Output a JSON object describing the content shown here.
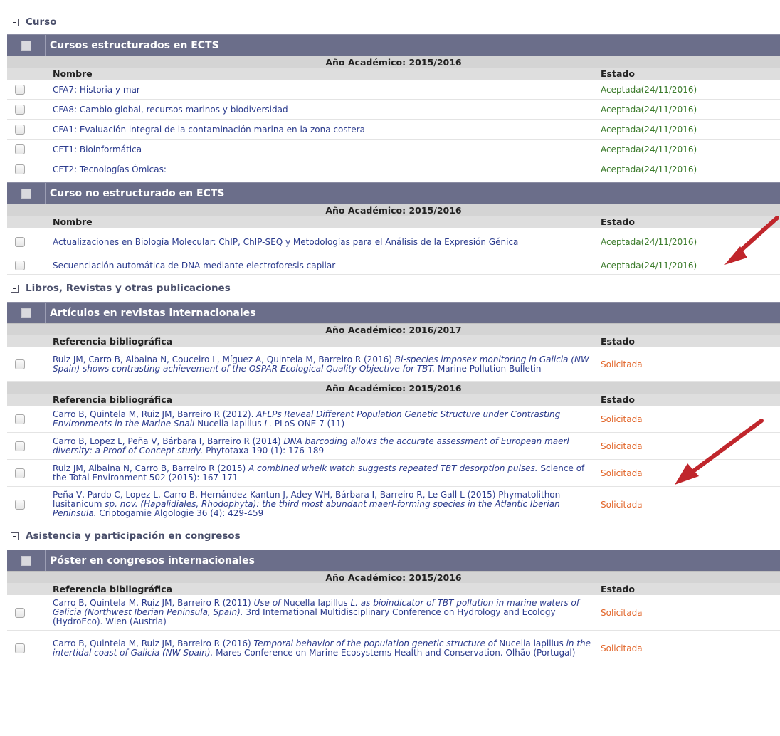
{
  "sections": {
    "curso": {
      "title": "Curso"
    },
    "libros": {
      "title": "Libros, Revistas y otras publicaciones"
    },
    "asistencia": {
      "title": "Asistencia y participación en congresos"
    }
  },
  "curso": {
    "ects": {
      "title": "Cursos estructurados en ECTS",
      "year": "Año Académico: 2015/2016",
      "col_name": "Nombre",
      "col_state": "Estado",
      "rows": [
        {
          "name": "CFA7: Historia y mar",
          "state": "Aceptada(24/11/2016)"
        },
        {
          "name": "CFA8: Cambio global, recursos marinos y biodiversidad",
          "state": "Aceptada(24/11/2016)"
        },
        {
          "name": "CFA1: Evaluación integral de la contaminación marina en la zona costera",
          "state": "Aceptada(24/11/2016)"
        },
        {
          "name": "CFT1: Bioinformática",
          "state": "Aceptada(24/11/2016)"
        },
        {
          "name": "CFT2: Tecnologías Ómicas:",
          "state": "Aceptada(24/11/2016)"
        }
      ]
    },
    "noects": {
      "title": "Curso no estructurado en ECTS",
      "year": "Año Académico: 2015/2016",
      "col_name": "Nombre",
      "col_state": "Estado",
      "rows": [
        {
          "name": "Actualizaciones en Biología Molecular: ChIP, ChIP-SEQ y Metodologías para el Análisis de la Expresión Génica",
          "state": "Aceptada(24/11/2016)"
        },
        {
          "name": "Secuenciación automática de DNA mediante electroforesis capilar",
          "state": "Aceptada(24/11/2016)"
        }
      ]
    }
  },
  "libros": {
    "articulos": {
      "title": "Artículos en revistas internacionales",
      "year1": "Año Académico: 2016/2017",
      "year2": "Año Académico: 2015/2016",
      "col_ref": "Referencia bibliográfica",
      "col_state": "Estado",
      "r1": {
        "a": "Ruiz JM, Carro B, Albaina N, Couceiro L, Míguez A, Quintela M, Barreiro R (2016) ",
        "i": "Bi-species imposex monitoring in Galicia (NW Spain) shows contrasting achievement of the OSPAR Ecological Quality Objective for TBT.",
        "b": " Marine Pollution Bulletin",
        "state": "Solicitada"
      },
      "r2": {
        "a": "Carro B, Quintela M, Ruiz JM, Barreiro R (2012). ",
        "i": "AFLPs Reveal Different Population Genetic Structure under Contrasting Environments in the Marine Snail",
        "b": " Nucella lapillus ",
        "i2": "L.",
        "c": " PLoS ONE 7 (11)",
        "state": "Solicitada"
      },
      "r3": {
        "a": "Carro B, Lopez L, Peña V, Bárbara I, Barreiro R (2014) ",
        "i": "DNA barcoding allows the accurate assessment of European maerl diversity: a Proof-of-Concept study.",
        "b": " Phytotaxa 190 (1): 176-189",
        "state": "Solicitada"
      },
      "r4": {
        "a": "Ruiz JM, Albaina N, Carro B, Barreiro R (2015) ",
        "i": "A combined whelk watch suggests repeated TBT desorption pulses.",
        "b": " Science of the Total Environment 502 (2015): 167-171",
        "state": "Solicitada"
      },
      "r5": {
        "a": "Peña V, Pardo C, Lopez L, Carro B, Hernández-Kantun J, Adey WH, Bárbara I, Barreiro R, Le Gall L (2015) Phymatolithon lusitanicum ",
        "i": "sp. nov. (Hapalidiales, Rhodophyta): the third most abundant maerl-forming species in the Atlantic Iberian Peninsula.",
        "b": " Criptogamie Algologie 36 (4): 429-459",
        "state": "Solicitada"
      }
    }
  },
  "asistencia": {
    "poster": {
      "title": "Póster en congresos internacionales",
      "year": "Año Académico: 2015/2016",
      "col_ref": "Referencia bibliográfica",
      "col_state": "Estado",
      "r1": {
        "a": "Carro B, Quintela M, Ruiz JM, Barreiro R (2011) ",
        "i": "Use of",
        "b": " Nucella lapillus ",
        "i2": "L. as bioindicator  of TBT pollution in marine waters of Galicia (Northwest Iberian Peninsula, Spain).",
        "c": " 3rd International Multidisciplinary Conference on Hydrology and Ecology (HydroEco). Wien (Austria)",
        "state": "Solicitada"
      },
      "r2": {
        "a": "Carro B, Quintela M, Ruiz JM, Barreiro R (2016) ",
        "i": "Temporal behavior of the population genetic structure of",
        "b": " Nucella lapillus ",
        "i2": "in the  intertidal coast of Galicia (NW Spain).",
        "c": " Mares Conference on Marine Ecosystems Health and Conservation. Olhão (Portugal)",
        "state": "Solicitada"
      }
    }
  },
  "colors": {
    "header": "#6b6e8a",
    "accepted": "#3a7a2a",
    "requested": "#e2662a",
    "arrow": "#c0262c"
  }
}
